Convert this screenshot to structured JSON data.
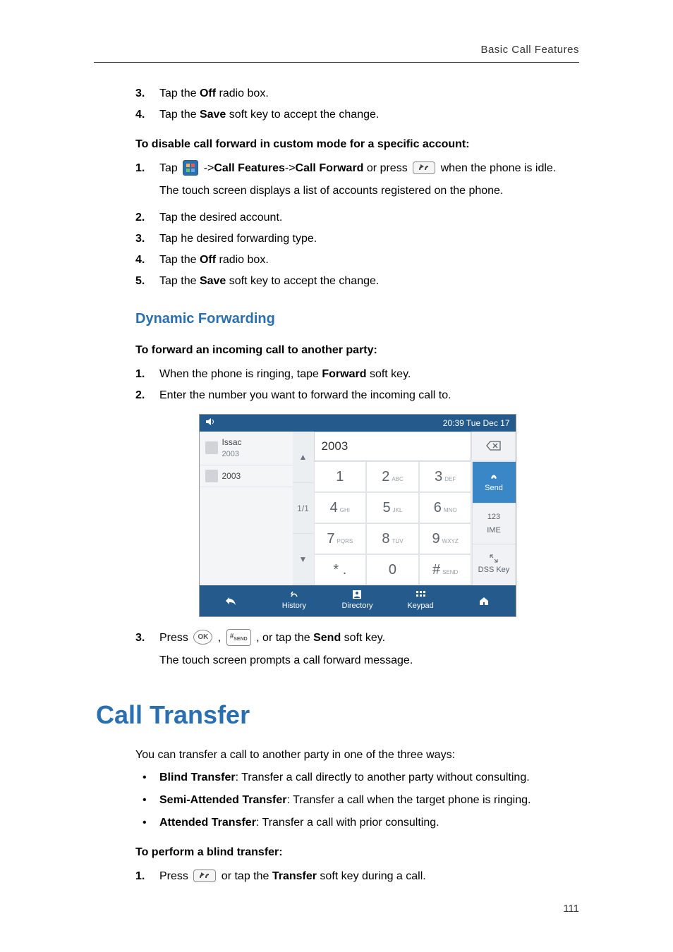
{
  "header": {
    "title": "Basic Call Features"
  },
  "footer": {
    "page": "111"
  },
  "sec1": {
    "items": [
      {
        "num": "3.",
        "a": "Tap the ",
        "b": "Off",
        "c": " radio box."
      },
      {
        "num": "4.",
        "a": "Tap the ",
        "b": "Save",
        "c": " soft key to accept the change."
      }
    ]
  },
  "sec2": {
    "title": "To disable call forward in custom mode for a specific account:",
    "items": [
      {
        "num": "1.",
        "p1": "Tap ",
        "p2": " ->",
        "b1": "Call Features",
        "p3": "->",
        "b2": "Call Forward",
        "p4": " or press ",
        "p5": " when the phone is idle.",
        "note": "The touch screen displays a list of accounts registered on the phone."
      },
      {
        "num": "2.",
        "a": "Tap the desired account."
      },
      {
        "num": "3.",
        "a": "Tap he desired forwarding type."
      },
      {
        "num": "4.",
        "a": "Tap the ",
        "b": "Off",
        "c": " radio box."
      },
      {
        "num": "5.",
        "a": "Tap the ",
        "b": "Save",
        "c": " soft key to accept the change."
      }
    ]
  },
  "sec3": {
    "heading": "Dynamic Forwarding",
    "title": "To forward an incoming call to another party:",
    "items": [
      {
        "num": "1.",
        "a": "When the phone is ringing, tape ",
        "b": "Forward",
        "c": " soft key."
      },
      {
        "num": "2.",
        "a": "Enter the number you want to forward the incoming call to."
      },
      {
        "num": "3.",
        "a": "Press ",
        "ok": "OK",
        "b": " , ",
        "hash": "#",
        "hashsub": "SEND",
        "c": " , or tap the ",
        "d": "Send",
        "e": " soft key.",
        "note": "The touch screen prompts a call forward message."
      }
    ]
  },
  "sec4": {
    "heading": "Call Transfer",
    "intro": "You can transfer a call to another party in one of the three ways:",
    "bullets": [
      {
        "b": "Blind Transfer",
        "t": ": Transfer a call directly to another party without consulting."
      },
      {
        "b": "Semi-Attended Transfer",
        "t": ": Transfer a call when the target phone is ringing."
      },
      {
        "b": "Attended Transfer",
        "t": ": Transfer a call with prior consulting."
      }
    ],
    "sub": "To perform a blind transfer:",
    "items": [
      {
        "num": "1.",
        "a": "Press ",
        "b": " or tap the ",
        "c": "Transfer",
        "d": " soft key during a call."
      }
    ]
  },
  "phone": {
    "status_time": "20:39 Tue Dec 17",
    "accounts": [
      {
        "name": "Issac",
        "ext": "2003"
      },
      {
        "ext": "2003"
      }
    ],
    "page_indicator": "1/1",
    "input_value": "2003",
    "keys": [
      {
        "d": "1"
      },
      {
        "d": "2",
        "s": "ABC"
      },
      {
        "d": "3",
        "s": "DEF"
      },
      {
        "d": "4",
        "s": "GHI"
      },
      {
        "d": "5",
        "s": "JKL"
      },
      {
        "d": "6",
        "s": "MNO"
      },
      {
        "d": "7",
        "s": "PQRS"
      },
      {
        "d": "8",
        "s": "TUV"
      },
      {
        "d": "9",
        "s": "WXYZ"
      },
      {
        "d": "* ."
      },
      {
        "d": "0"
      },
      {
        "d": "#",
        "s": "SEND"
      }
    ],
    "side": {
      "0": "Send",
      "1a": "123",
      "1b": "IME",
      "2": "DSS Key"
    },
    "bottom": {
      "0": "History",
      "1": "Directory",
      "2": "Keypad"
    }
  }
}
